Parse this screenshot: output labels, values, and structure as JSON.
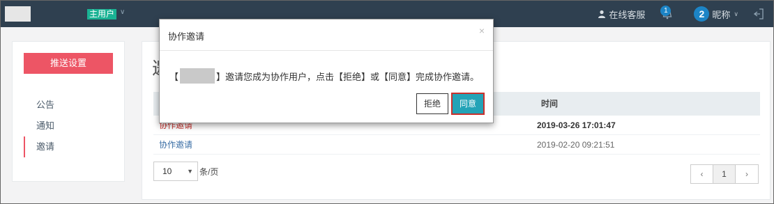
{
  "header": {
    "role_label": "主用户",
    "service_label": "在线客服",
    "notification_count": "1",
    "avatar_letter": "2",
    "nickname": "昵称"
  },
  "sidebar": {
    "push_button": "推送设置",
    "items": [
      {
        "label": "公告",
        "active": false
      },
      {
        "label": "通知",
        "active": false
      },
      {
        "label": "邀请",
        "active": true
      }
    ]
  },
  "main": {
    "title": "邀",
    "table": {
      "time_header": "时间",
      "rows": [
        {
          "name": "协作邀请",
          "time": "2019-03-26 17:01:47",
          "unread": true
        },
        {
          "name": "协作邀请",
          "time": "2019-02-20 09:21:51",
          "unread": false
        }
      ]
    },
    "page_size": "10",
    "page_size_label": "条/页",
    "pagination": {
      "prev": "‹",
      "current": "1",
      "next": "›"
    }
  },
  "modal": {
    "title": "协作邀请",
    "close": "×",
    "text_before": "【",
    "text_after": "】邀请您成为协作用户，点击【拒绝】或【同意】完成协作邀请。",
    "reject_label": "拒绝",
    "accept_label": "同意"
  },
  "colors": {
    "topbar": "#2f4050",
    "accent_green": "#1ab394",
    "danger": "#ed5565",
    "accept_btn": "#23a3b7"
  }
}
